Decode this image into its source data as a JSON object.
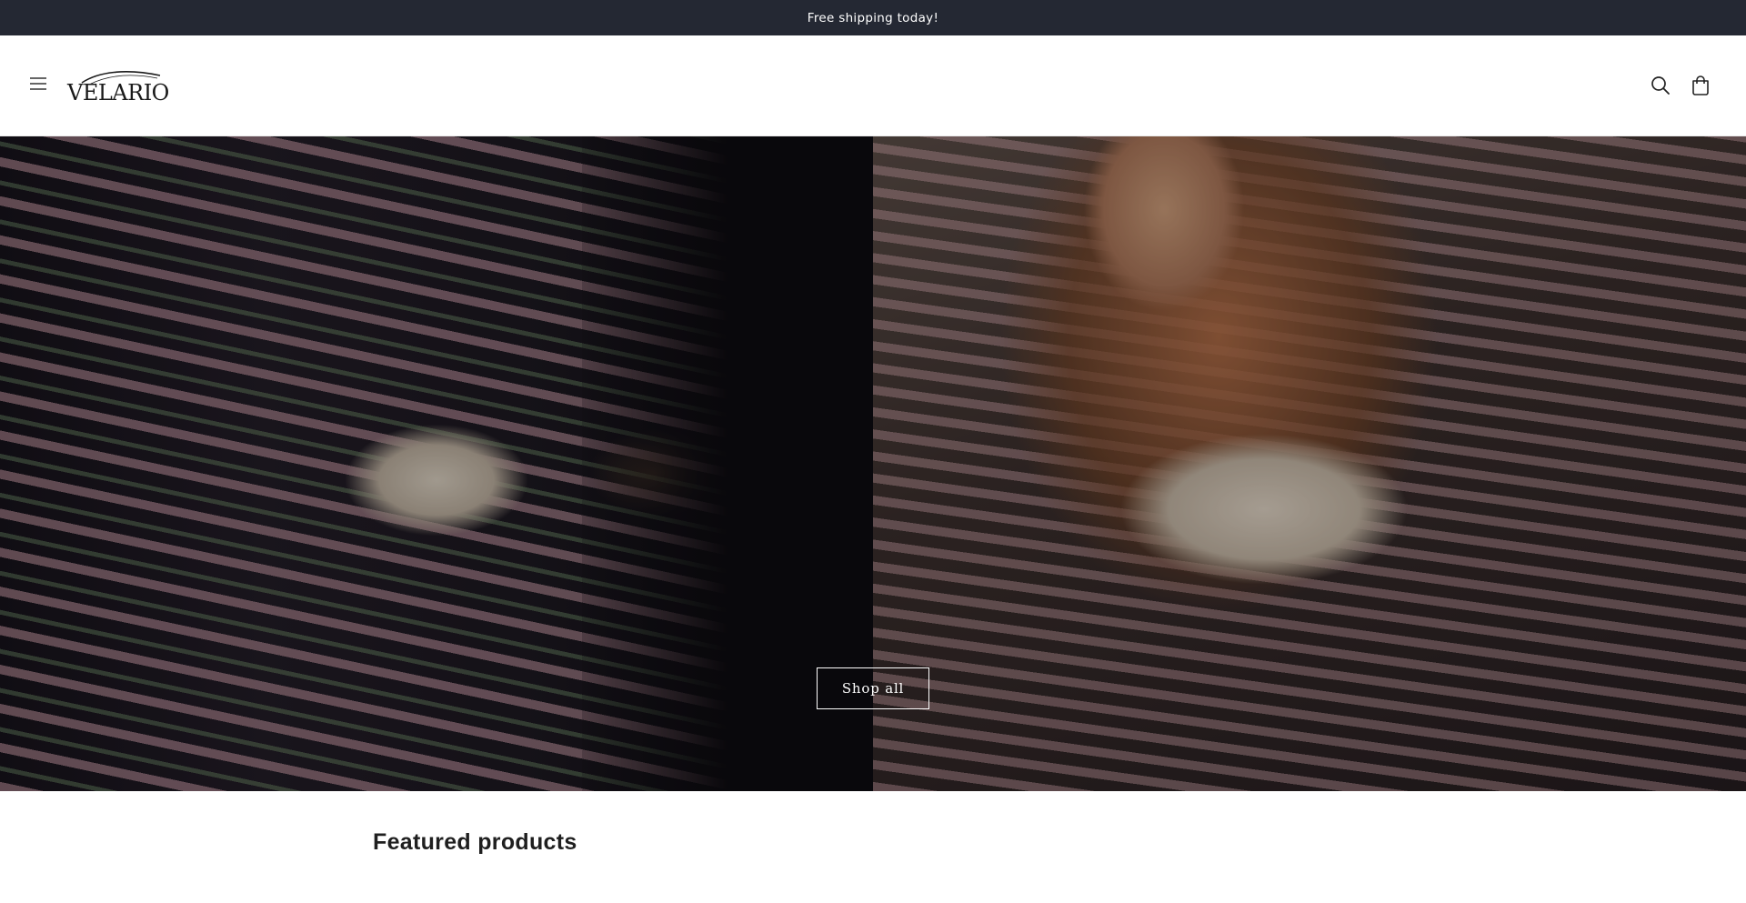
{
  "announcement": {
    "text": "Free shipping today!"
  },
  "header": {
    "logo_text": "VELARIO",
    "menu_icon": "hamburger-menu-icon",
    "search_icon": "search-icon",
    "cart_icon": "cart-bag-icon"
  },
  "hero": {
    "button_label": "Shop all"
  },
  "featured": {
    "title": "Featured products"
  },
  "colors": {
    "announcement_bg": "#242833",
    "announcement_text": "#ffffff",
    "header_bg": "#ffffff",
    "button_border": "#ffffff"
  }
}
